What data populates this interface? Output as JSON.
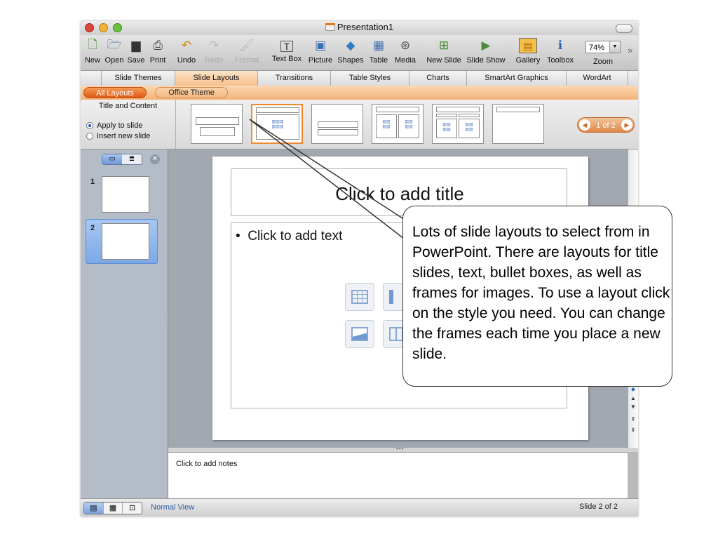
{
  "window": {
    "title": "Presentation1"
  },
  "toolbar": {
    "buttons": [
      {
        "label": "New",
        "icon": "new-icon"
      },
      {
        "label": "Open",
        "icon": "open-icon"
      },
      {
        "label": "Save",
        "icon": "save-icon"
      },
      {
        "label": "Print",
        "icon": "print-icon"
      },
      {
        "label": "Undo",
        "icon": "undo-icon"
      },
      {
        "label": "Redo",
        "icon": "redo-icon",
        "disabled": true
      },
      {
        "label": "Format",
        "icon": "format-icon",
        "disabled": true
      },
      {
        "label": "Text Box",
        "icon": "text-box-icon"
      },
      {
        "label": "Picture",
        "icon": "picture-icon"
      },
      {
        "label": "Shapes",
        "icon": "shapes-icon"
      },
      {
        "label": "Table",
        "icon": "table-icon"
      },
      {
        "label": "Media",
        "icon": "media-icon"
      },
      {
        "label": "New Slide",
        "icon": "new-slide-icon"
      },
      {
        "label": "Slide Show",
        "icon": "slide-show-icon"
      },
      {
        "label": "Gallery",
        "icon": "gallery-icon"
      },
      {
        "label": "Toolbox",
        "icon": "toolbox-icon"
      }
    ],
    "zoom_value": "74%",
    "zoom_label": "Zoom"
  },
  "ribbon_tabs": [
    "Slide Themes",
    "Slide Layouts",
    "Transitions",
    "Table Styles",
    "Charts",
    "SmartArt Graphics",
    "WordArt"
  ],
  "active_tab": "Slide Layouts",
  "gallery": {
    "group_all": "All Layouts",
    "group_theme": "Office Theme",
    "selected_layout_name": "Title and Content",
    "apply_to_slide": "Apply to slide",
    "insert_new_slide": "Insert new slide",
    "pager": "1 of 2"
  },
  "slides_pane": {
    "numbers": [
      "1",
      "2"
    ]
  },
  "slide": {
    "title_placeholder": "Click to add title",
    "body_placeholder": "Click to add text"
  },
  "notes": {
    "placeholder": "Click to add notes"
  },
  "status": {
    "view": "Normal View",
    "slide_count": "Slide 2 of 2"
  },
  "callout": {
    "text": "Lots of slide layouts to select from in PowerPoint.  There are layouts for title slides, text, bullet boxes, as well as frames for images. To use a layout click on the style you need. You can change the frames each time you place a new slide."
  },
  "colors": {
    "accent_orange": "#ef8a33",
    "selection_blue": "#7ca9e6",
    "status_link": "#2d5ea8"
  }
}
